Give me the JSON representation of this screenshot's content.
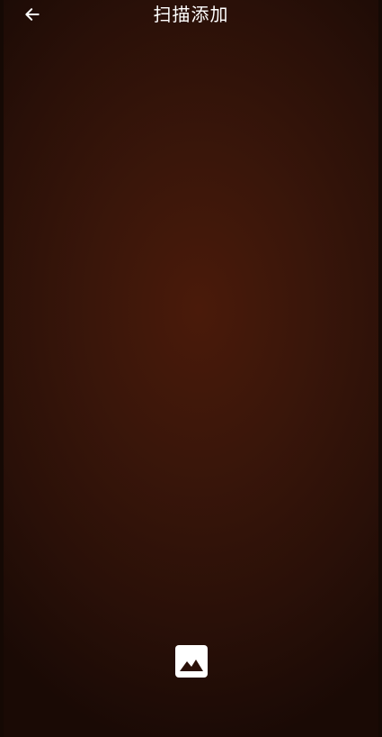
{
  "header": {
    "title": "扫描添加",
    "back_icon": "arrow-left-icon"
  },
  "footer": {
    "gallery_icon": "image-icon"
  },
  "colors": {
    "background_center": "#4a1a0a",
    "background_edge": "#1a0a05",
    "foreground": "#ffffff"
  }
}
